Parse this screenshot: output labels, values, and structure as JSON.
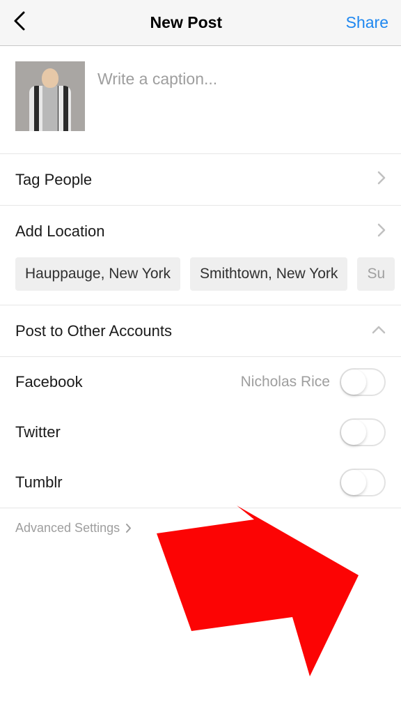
{
  "header": {
    "title": "New Post",
    "share": "Share"
  },
  "caption": {
    "placeholder": "Write a caption..."
  },
  "rows": {
    "tagPeople": "Tag People",
    "addLocation": "Add Location",
    "postToOther": "Post to Other Accounts"
  },
  "locations": {
    "chip1": "Hauppauge, New York",
    "chip2": "Smithtown, New York",
    "chip3": "Su"
  },
  "accounts": {
    "facebook": {
      "label": "Facebook",
      "user": "Nicholas Rice"
    },
    "twitter": {
      "label": "Twitter"
    },
    "tumblr": {
      "label": "Tumblr"
    }
  },
  "advanced": "Advanced Settings"
}
